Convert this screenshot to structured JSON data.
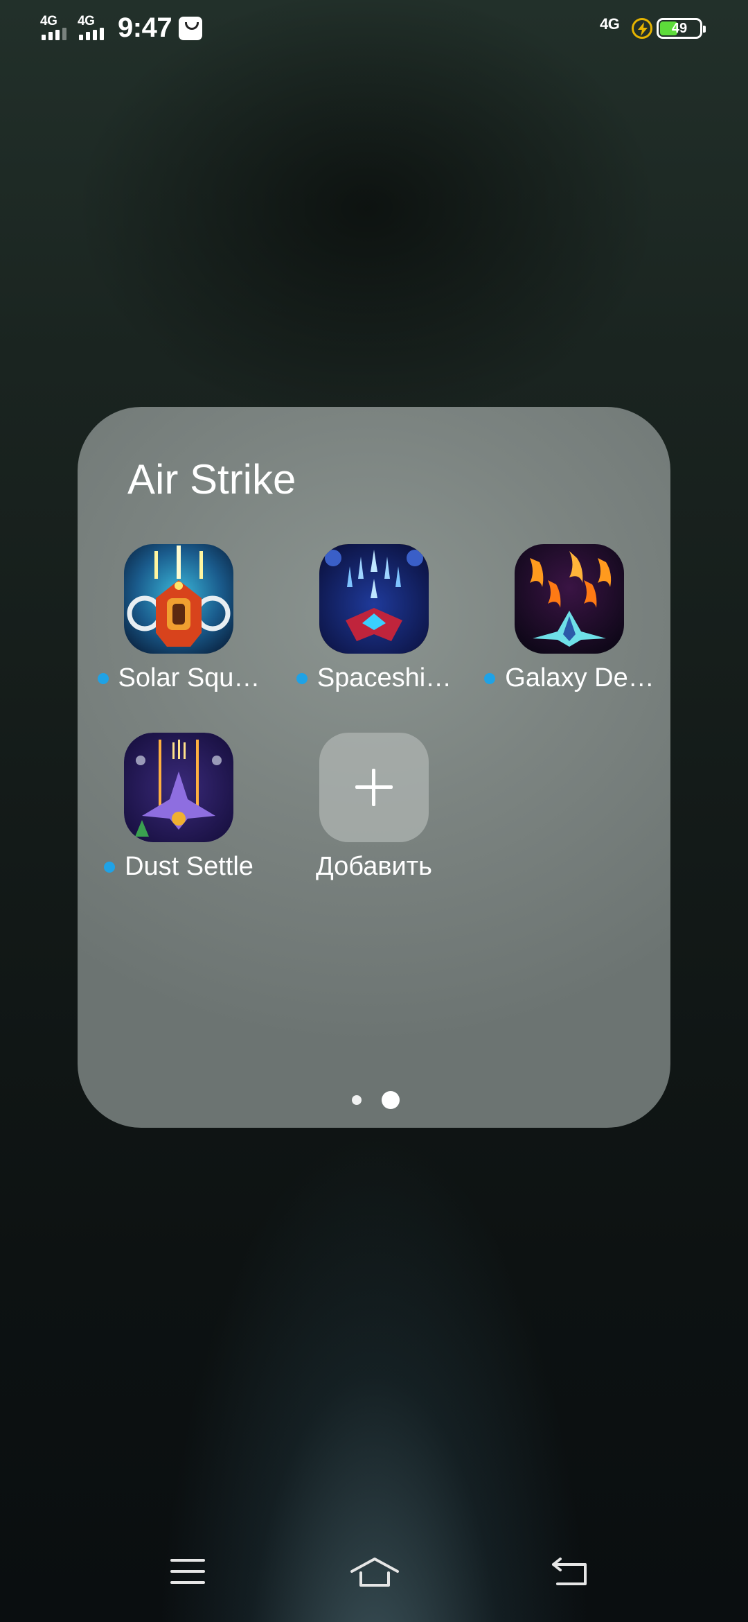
{
  "status_bar": {
    "sim1_network": "4G",
    "sim2_network": "4G",
    "time": "9:47",
    "right_network": "4G",
    "battery_percent": "49",
    "battery_level": 0.49,
    "notification_icon": "shopping-bag-icon",
    "charging_icon": "bolt-icon"
  },
  "folder": {
    "title": "Air Strike",
    "apps": [
      {
        "label": "Solar Squ…",
        "new_indicator": true,
        "icon": "solar-squad-app-icon"
      },
      {
        "label": "Spaceshi…",
        "new_indicator": true,
        "icon": "spaceship-app-icon"
      },
      {
        "label": "Galaxy De…",
        "new_indicator": true,
        "icon": "galaxy-defense-app-icon"
      },
      {
        "label": "Dust Settle",
        "new_indicator": true,
        "icon": "dust-settle-app-icon"
      }
    ],
    "add_button_label": "Добавить",
    "pages": {
      "count": 2,
      "current": 2
    }
  },
  "nav_bar": {
    "menu_icon": "menu-icon",
    "home_icon": "home-icon",
    "back_icon": "back-icon"
  },
  "colors": {
    "new_dot": "#1fa2e6",
    "battery_fill": "#5ddc3a",
    "charging": "#e6b400"
  }
}
